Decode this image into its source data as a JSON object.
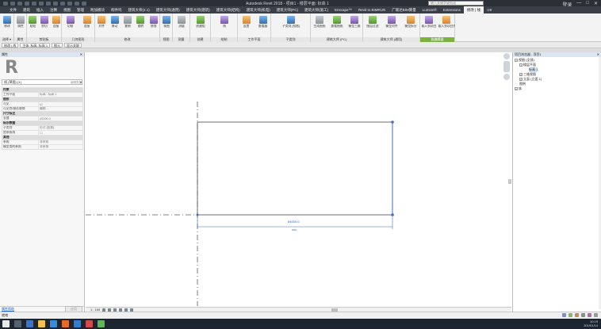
{
  "titlebar": {
    "title": "Autodesk Revit 2018 - 项目1 - 楼层平面: 标高 1",
    "search_placeholder": "键入关键字或短语",
    "sign_in": "登录"
  },
  "menu": {
    "tabs": [
      "文件",
      "建筑",
      "插入",
      "注释",
      "视图",
      "管理",
      "附加模块",
      "构件坞",
      "建筑大师(2.1)",
      "建筑大师(通用)",
      "建筑大师(建筑)",
      "建筑大师(结构)",
      "建筑大师(机电)",
      "建筑大师(PC)",
      "建筑大师(施工)",
      "Enscape™",
      "Revit to BIMRUN",
      "广联达BIM算量",
      "Lumion®",
      "Extensions",
      "修改 | 线",
      "⊙▾"
    ],
    "active_index": 20
  },
  "ribbon": {
    "groups": [
      {
        "label": "选择 ▾",
        "buttons": [
          "修改"
        ]
      },
      {
        "label": "属性",
        "buttons": [
          "属性"
        ]
      },
      {
        "label": "剪贴板",
        "buttons": [
          "粘贴",
          "剪切",
          "连接"
        ]
      },
      {
        "label": "几何图形",
        "buttons": [
          "切割",
          "连接"
        ]
      },
      {
        "label": "修改",
        "buttons": [
          "对齐",
          "移动",
          "复制",
          "旋转",
          "修剪"
        ]
      },
      {
        "label": "视图",
        "buttons": [
          "视图"
        ]
      },
      {
        "label": "测量",
        "buttons": [
          "测量"
        ]
      },
      {
        "label": "创建",
        "buttons": [
          "创建组"
        ]
      },
      {
        "label": "绘制",
        "buttons": [
          "线"
        ]
      },
      {
        "label": "工作平面",
        "buttons": [
          "设置",
          "查看器"
        ]
      },
      {
        "label": "子类别",
        "buttons": [
          "子类别 [投影]"
        ]
      },
      {
        "label": "建筑大师 (PC)",
        "buttons": [
          "生成图纸",
          "查看图纸",
          "模型三维"
        ]
      },
      {
        "label": "建筑大师 (通用)",
        "buttons": [
          "图层过滤",
          "模型对齐",
          "模型拆分"
        ]
      },
      {
        "label": "族编辑器",
        "buttons": [
          "载入到项目",
          "载入到项目并关闭"
        ]
      }
    ]
  },
  "optbar": {
    "items": [
      "修改 | 线",
      "主体: 标高: 标高 1",
      "图元",
      "显示关联"
    ]
  },
  "properties": {
    "header": "属性",
    "type_selector": "线 (草图) (1)",
    "edit_type": "编辑类型",
    "rows": [
      {
        "kind": "cat",
        "label": "约束"
      },
      {
        "kind": "row",
        "label": "工作平面",
        "value": "标高 : 标高 1"
      },
      {
        "kind": "cat",
        "label": "图形"
      },
      {
        "kind": "row",
        "label": "可见",
        "value": "☑"
      },
      {
        "kind": "row",
        "label": "可见性/图形替换",
        "value": "编辑..."
      },
      {
        "kind": "cat",
        "label": "尺寸标注"
      },
      {
        "kind": "row",
        "label": "长度",
        "value": "40000.0"
      },
      {
        "kind": "cat",
        "label": "标识数据"
      },
      {
        "kind": "row",
        "label": "子类别",
        "value": "形式 [投影]"
      },
      {
        "kind": "row",
        "label": "是参照线",
        "value": "☐"
      },
      {
        "kind": "cat",
        "label": "其他"
      },
      {
        "kind": "row",
        "label": "参照",
        "value": "非参照"
      },
      {
        "kind": "row",
        "label": "模型类的参照",
        "value": "非参照"
      }
    ],
    "help_link": "属性帮助",
    "apply": "应用"
  },
  "canvas": {
    "dimension": "84000.0"
  },
  "viewctrl": {
    "scale": "1 : 100"
  },
  "browser": {
    "header": "项目浏览器 - 项目1",
    "nodes": [
      {
        "depth": 0,
        "twisty": "−",
        "label": "视图 (全部)",
        "selected": false
      },
      {
        "depth": 1,
        "twisty": "−",
        "label": "楼层平面",
        "selected": false
      },
      {
        "depth": 2,
        "twisty": "",
        "label": "标高 1",
        "selected": true
      },
      {
        "depth": 1,
        "twisty": "+",
        "label": "三维视图",
        "selected": false
      },
      {
        "depth": 1,
        "twisty": "+",
        "label": "立面 (立面 1)",
        "selected": false
      },
      {
        "depth": 0,
        "twisty": "",
        "label": "图例",
        "selected": false
      },
      {
        "depth": 0,
        "twisty": "+",
        "label": "族",
        "selected": false
      }
    ]
  },
  "statusbar": {
    "text": "就绪"
  },
  "taskbar": {
    "time": "10:19",
    "date": "2019/1/14"
  }
}
